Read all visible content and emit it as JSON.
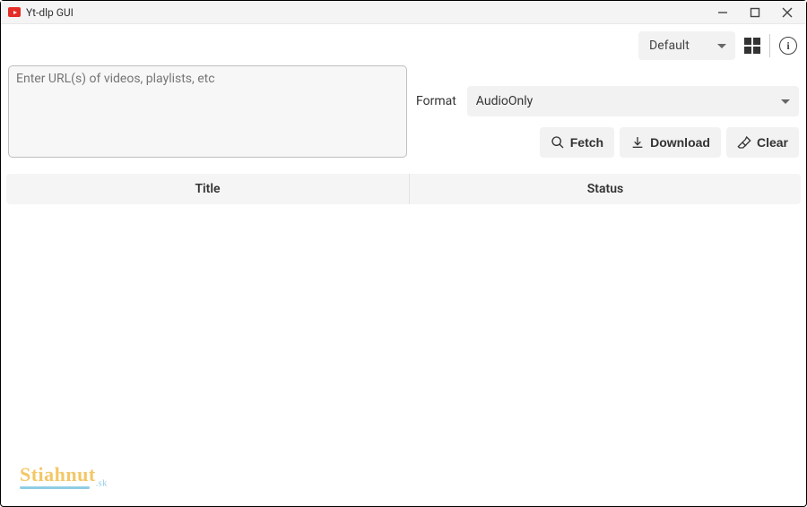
{
  "titlebar": {
    "title": "Yt-dlp GUI"
  },
  "toolbar": {
    "profile_selected": "Default"
  },
  "url_input": {
    "placeholder": "Enter URL(s) of videos, playlists, etc",
    "value": ""
  },
  "format": {
    "label": "Format",
    "selected": "AudioOnly"
  },
  "actions": {
    "fetch": "Fetch",
    "download": "Download",
    "clear": "Clear"
  },
  "table": {
    "columns": {
      "title": "Title",
      "status": "Status"
    },
    "rows": []
  },
  "watermark": {
    "text": "Stiahnut",
    "suffix": ".sk"
  }
}
